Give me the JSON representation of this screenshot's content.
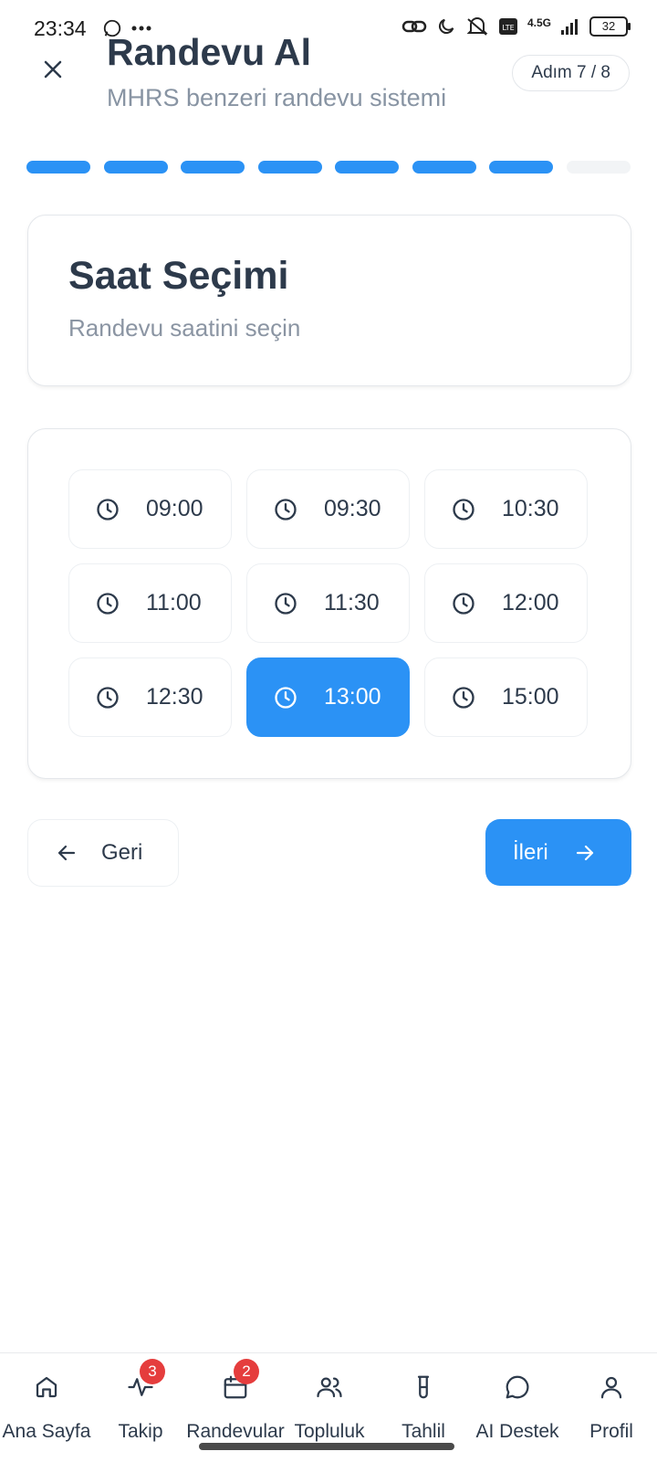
{
  "status_bar": {
    "time": "23:34",
    "battery": "32",
    "network": "4.5G"
  },
  "header": {
    "title": "Randevu Al",
    "subtitle": "MHRS benzeri randevu sistemi",
    "step_label": "Adım 7 / 8"
  },
  "progress": {
    "total_steps": 8,
    "current_step": 7
  },
  "card": {
    "title": "Saat Seçimi",
    "subtitle": "Randevu saatini seçin"
  },
  "time_slots": [
    {
      "time": "09:00",
      "selected": false
    },
    {
      "time": "09:30",
      "selected": false
    },
    {
      "time": "10:30",
      "selected": false
    },
    {
      "time": "11:00",
      "selected": false
    },
    {
      "time": "11:30",
      "selected": false
    },
    {
      "time": "12:00",
      "selected": false
    },
    {
      "time": "12:30",
      "selected": false
    },
    {
      "time": "13:00",
      "selected": true
    },
    {
      "time": "15:00",
      "selected": false
    }
  ],
  "buttons": {
    "back": "Geri",
    "next": "İleri"
  },
  "bottom_nav": [
    {
      "label": "Ana Sayfa",
      "icon": "home-icon",
      "badge": null
    },
    {
      "label": "Takip",
      "icon": "activity-icon",
      "badge": "3"
    },
    {
      "label": "Randevular",
      "icon": "calendar-icon",
      "badge": "2"
    },
    {
      "label": "Topluluk",
      "icon": "users-icon",
      "badge": null
    },
    {
      "label": "Tahlil",
      "icon": "test-tube-icon",
      "badge": null
    },
    {
      "label": "AI Destek",
      "icon": "chat-icon",
      "badge": null
    },
    {
      "label": "Profil",
      "icon": "user-icon",
      "badge": null
    }
  ],
  "colors": {
    "primary": "#2b92f5",
    "badge": "#e53d3d",
    "text": "#2d3a4b",
    "muted": "#8894a3"
  }
}
